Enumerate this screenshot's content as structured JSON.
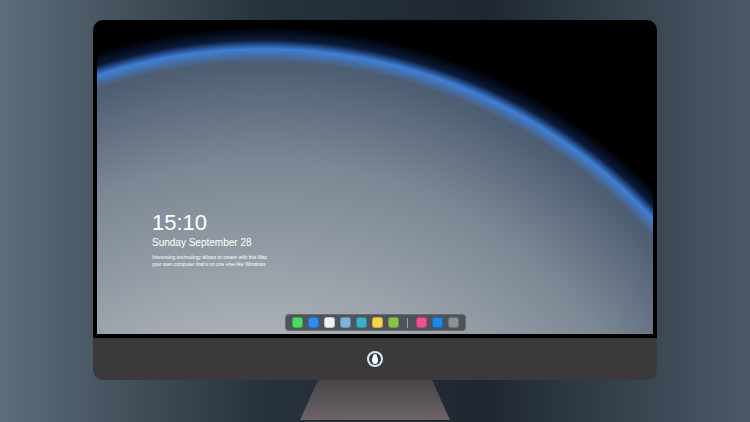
{
  "lock_screen": {
    "time": "15:10",
    "date": "Sunday September 28",
    "message_lines": [
      "Interesting technology allows to create with this Mac",
      "your own computer that's no one else like Windows"
    ]
  },
  "dock": {
    "items": [
      {
        "kind": "app",
        "color": "#4cd964"
      },
      {
        "kind": "app",
        "color": "#2f8cf0"
      },
      {
        "kind": "app",
        "color": "#f2f2f2"
      },
      {
        "kind": "app",
        "color": "#7fb3d9"
      },
      {
        "kind": "app",
        "color": "#3ab0c8"
      },
      {
        "kind": "app",
        "color": "#f7d54a"
      },
      {
        "kind": "app",
        "color": "#8bc34a"
      },
      {
        "kind": "separator"
      },
      {
        "kind": "app",
        "color": "#f0508c"
      },
      {
        "kind": "app",
        "color": "#1e88e5"
      },
      {
        "kind": "app",
        "color": "#8e8e93"
      }
    ]
  }
}
